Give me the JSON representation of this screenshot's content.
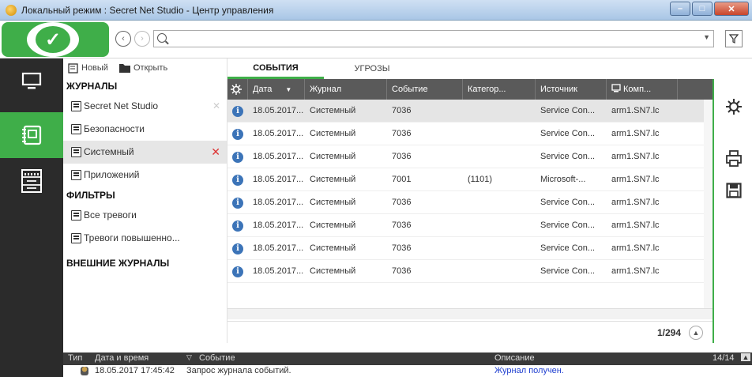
{
  "window": {
    "title": "Локальный режим : Secret Net Studio - Центр управления"
  },
  "toolbar": {
    "search_value": "",
    "search_placeholder": ""
  },
  "tree": {
    "new_label": "Новый",
    "open_label": "Открыть",
    "journals_header": "ЖУРНАЛЫ",
    "journals": [
      {
        "label": "Secret Net Studio"
      },
      {
        "label": "Безопасности"
      },
      {
        "label": "Системный"
      },
      {
        "label": "Приложений"
      }
    ],
    "filters_header": "ФИЛЬТРЫ",
    "filters": [
      {
        "label": "Все тревоги"
      },
      {
        "label": "Тревоги повышенно..."
      }
    ],
    "external_header": "ВНЕШНИЕ ЖУРНАЛЫ"
  },
  "tabs": [
    {
      "label": "СОБЫТИЯ"
    },
    {
      "label": "УГРОЗЫ"
    }
  ],
  "grid": {
    "columns": [
      "Дата",
      "Журнал",
      "Событие",
      "Категор...",
      "Источник",
      "Комп..."
    ],
    "rows": [
      {
        "date": "18.05.2017...",
        "journal": "Системный",
        "event": "7036",
        "category": "",
        "source": "Service Con...",
        "computer": "arm1.SN7.lc"
      },
      {
        "date": "18.05.2017...",
        "journal": "Системный",
        "event": "7036",
        "category": "",
        "source": "Service Con...",
        "computer": "arm1.SN7.lc"
      },
      {
        "date": "18.05.2017...",
        "journal": "Системный",
        "event": "7036",
        "category": "",
        "source": "Service Con...",
        "computer": "arm1.SN7.lc"
      },
      {
        "date": "18.05.2017...",
        "journal": "Системный",
        "event": "7001",
        "category": "(1101)",
        "source": "Microsoft-...",
        "computer": "arm1.SN7.lc"
      },
      {
        "date": "18.05.2017...",
        "journal": "Системный",
        "event": "7036",
        "category": "",
        "source": "Service Con...",
        "computer": "arm1.SN7.lc"
      },
      {
        "date": "18.05.2017...",
        "journal": "Системный",
        "event": "7036",
        "category": "",
        "source": "Service Con...",
        "computer": "arm1.SN7.lc"
      },
      {
        "date": "18.05.2017...",
        "journal": "Системный",
        "event": "7036",
        "category": "",
        "source": "Service Con...",
        "computer": "arm1.SN7.lc"
      },
      {
        "date": "18.05.2017...",
        "journal": "Системный",
        "event": "7036",
        "category": "",
        "source": "Service Con...",
        "computer": "arm1.SN7.lc"
      }
    ]
  },
  "pager": {
    "text": "1/294"
  },
  "bottom": {
    "type_label": "Тип",
    "datetime_label": "Дата и время",
    "event_label": "Событие",
    "description_label": "Описание",
    "count": "14/14",
    "row": {
      "datetime": "18.05.2017 17:45:42",
      "event": "Запрос журнала событий.",
      "description": "Журнал получен."
    }
  },
  "colors": {
    "accent": "#3fae49",
    "dark_nav": "#2b2b2b",
    "header": "#5a5a5a",
    "info_icon": "#3c74b8"
  }
}
